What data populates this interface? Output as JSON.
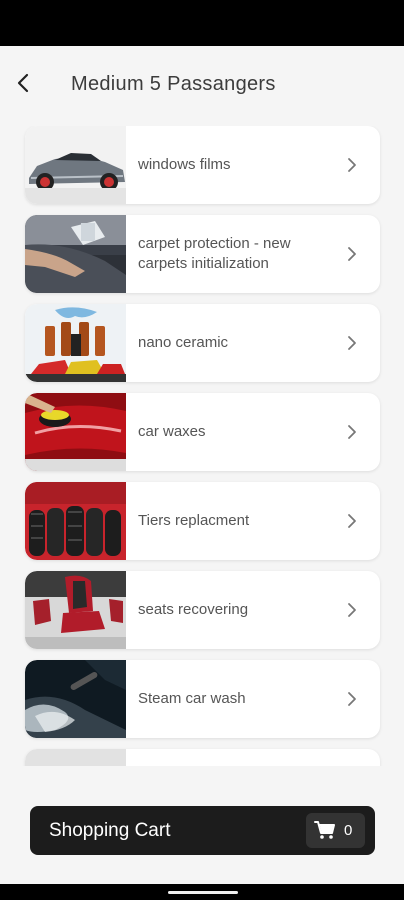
{
  "header": {
    "title": "Medium 5 Passangers",
    "back_icon": "arrow-left-icon"
  },
  "services": [
    {
      "label": "windows films",
      "image": "sports-car-photo"
    },
    {
      "label": "carpet protection - new carpets initialization",
      "image": "carpet-treatment-photo"
    },
    {
      "label": "nano ceramic",
      "image": "ceramic-bottles-photo"
    },
    {
      "label": "car waxes",
      "image": "car-polishing-photo"
    },
    {
      "label": "Tiers replacment",
      "image": "tires-photo"
    },
    {
      "label": "seats recovering",
      "image": "car-seats-photo"
    },
    {
      "label": "Steam car wash",
      "image": "steam-wash-photo"
    },
    {
      "label": "",
      "image": "partially-visible-item"
    }
  ],
  "cart": {
    "label": "Shopping Cart",
    "count": "0",
    "icon": "shopping-cart-icon"
  },
  "colors": {
    "screen_background": "#f5f5f5",
    "card_background": "#ffffff",
    "cart_background": "#1c1c1c",
    "text_primary": "#3c3c3c"
  }
}
